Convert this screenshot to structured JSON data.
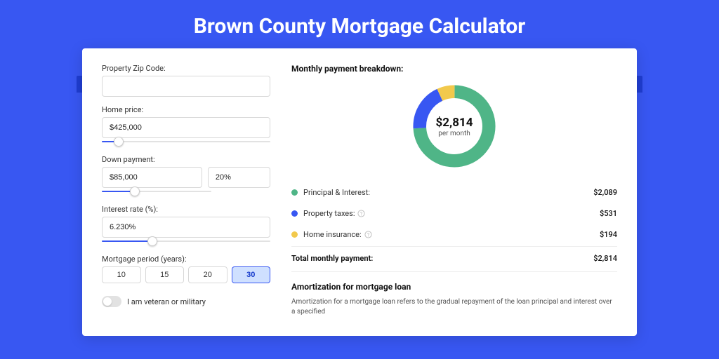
{
  "page_title": "Brown County Mortgage Calculator",
  "form": {
    "zip_label": "Property Zip Code:",
    "zip_value": "",
    "home_price_label": "Home price:",
    "home_price_value": "$425,000",
    "down_payment_label": "Down payment:",
    "down_payment_value": "$85,000",
    "down_payment_pct": "20%",
    "interest_label": "Interest rate (%):",
    "interest_value": "6.230%",
    "period_label": "Mortgage period (years):",
    "periods": [
      "10",
      "15",
      "20",
      "30"
    ],
    "period_active": "30",
    "veteran_label": "I am veteran or military"
  },
  "breakdown": {
    "title": "Monthly payment breakdown:",
    "center_amount": "$2,814",
    "center_per": "per month",
    "items": [
      {
        "key": "pi",
        "label": "Principal & Interest:",
        "value": "$2,089"
      },
      {
        "key": "tax",
        "label": "Property taxes:",
        "value": "$531",
        "help": true
      },
      {
        "key": "ins",
        "label": "Home insurance:",
        "value": "$194",
        "help": true
      }
    ],
    "total_label": "Total monthly payment:",
    "total_value": "$2,814"
  },
  "amort": {
    "title": "Amortization for mortgage loan",
    "text": "Amortization for a mortgage loan refers to the gradual repayment of the loan principal and interest over a specified"
  },
  "chart_data": {
    "type": "pie",
    "title": "Monthly payment breakdown",
    "series": [
      {
        "name": "Principal & Interest",
        "value": 2089,
        "color": "#4fb587"
      },
      {
        "name": "Property taxes",
        "value": 531,
        "color": "#3857f2"
      },
      {
        "name": "Home insurance",
        "value": 194,
        "color": "#f2c94c"
      }
    ],
    "total": 2814,
    "center_label": "$2,814 per month"
  }
}
